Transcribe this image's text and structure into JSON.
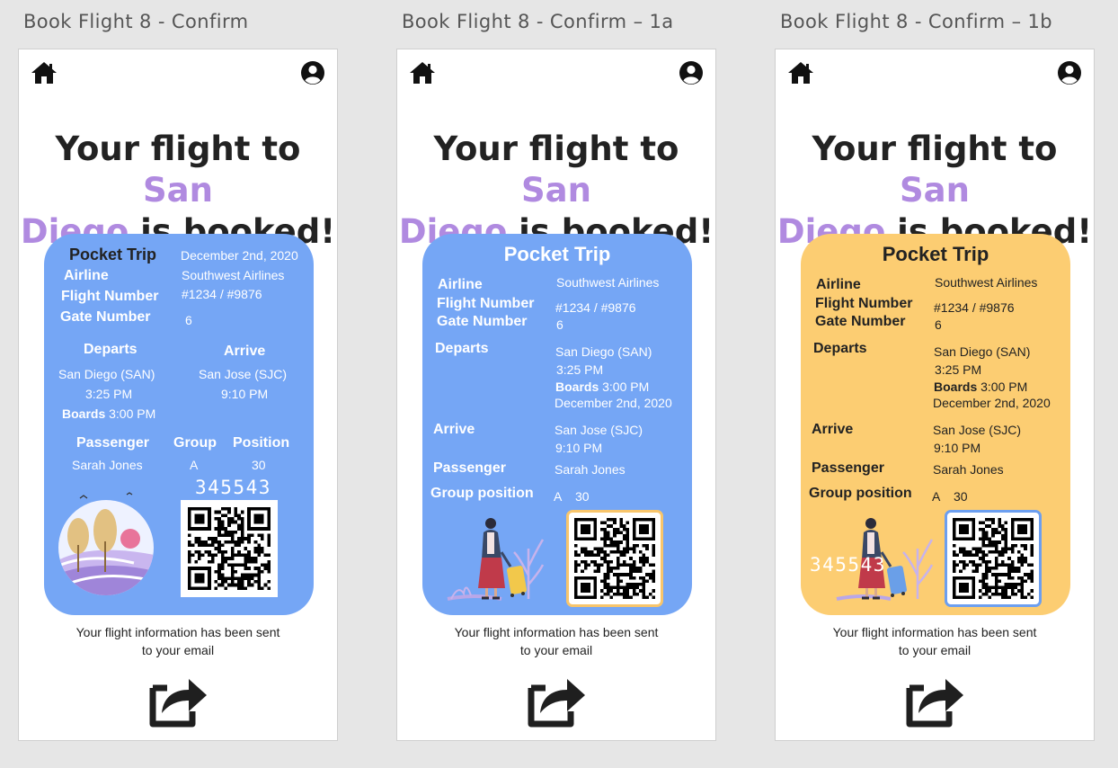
{
  "frames": [
    {
      "title": "Book Flight 8 - Confirm"
    },
    {
      "title": "Book Flight 8 - Confirm – 1a"
    },
    {
      "title": "Book Flight 8 - Confirm – 1b"
    }
  ],
  "headline": {
    "line1_prefix": "Your flight to ",
    "city_part1": "San",
    "city_part2": "Diego",
    "line2_suffix": " is booked!"
  },
  "ticket": {
    "brand": "Pocket Trip",
    "date": "December 2nd, 2020",
    "airline_label": "Airline",
    "airline": "Southwest Airlines",
    "flight_number_label": "Flight Number",
    "flight_number": "#1234 / #9876",
    "gate_label": "Gate Number",
    "gate": "6",
    "departs_label": "Departs",
    "departs_from": "San Diego (SAN)",
    "departs_time": "3:25 PM",
    "boards_label": "Boards",
    "boards_time": "3:00 PM",
    "arrive_label": "Arrive",
    "arrive_to": "San Jose (SJC)",
    "arrive_time": "9:10 PM",
    "passenger_label": "Passenger",
    "passenger": "Sarah Jones",
    "group_label": "Group",
    "group": "A",
    "position_label": "Position",
    "position": "30",
    "group_position_label": "Group position",
    "confirmation_code": "345543"
  },
  "footer": {
    "message_line1": "Your flight information has been sent",
    "message_line2": "to your email"
  },
  "icons": {
    "home": "home-icon",
    "profile": "user-circle-icon",
    "share": "share-icon",
    "qr": "qr-code"
  },
  "colors": {
    "accent": "#b08ae0",
    "card_blue": "#75a6f5",
    "card_yellow": "#fccd72",
    "qr_border_yellow": "#f8c56b",
    "qr_border_blue": "#6c9ff0"
  }
}
